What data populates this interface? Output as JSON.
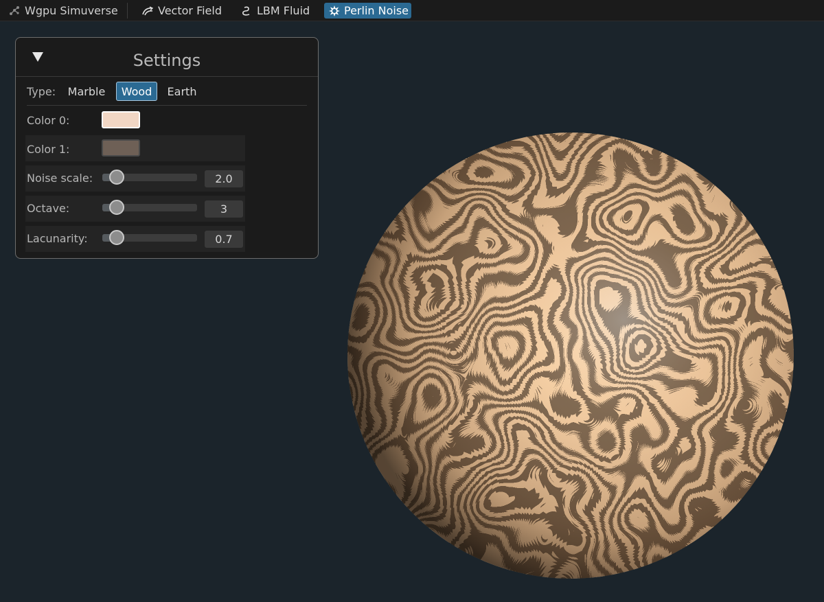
{
  "topbar": {
    "tabs": [
      {
        "label": "Wgpu Simuverse",
        "icon": "molecule-icon"
      },
      {
        "label": "Vector Field",
        "icon": "field-lines-icon"
      },
      {
        "label": "LBM Fluid",
        "icon": "swirl-icon"
      },
      {
        "label": "Perlin Noise",
        "icon": "starburst-icon"
      }
    ],
    "active_tab": "Perlin Noise",
    "active_color": "#2b6a93"
  },
  "settings": {
    "title": "Settings",
    "type": {
      "label": "Type:",
      "options": [
        "Marble",
        "Wood",
        "Earth"
      ],
      "selected": "Wood"
    },
    "color0": {
      "label": "Color 0:",
      "value": "#f1d6c4"
    },
    "color1": {
      "label": "Color 1:",
      "value": "#6e6056"
    },
    "noise_scale": {
      "label": "Noise scale:",
      "value": "2.0",
      "fraction": 0.05
    },
    "octave": {
      "label": "Octave:",
      "value": "3",
      "fraction": 0.05
    },
    "lacunarity": {
      "label": "Lacunarity:",
      "value": "0.7",
      "fraction": 0.05
    }
  },
  "viewport": {
    "object": "sphere",
    "texture": "wood",
    "light_color": "#fff0d8",
    "dark_color": "#2a1d12"
  }
}
